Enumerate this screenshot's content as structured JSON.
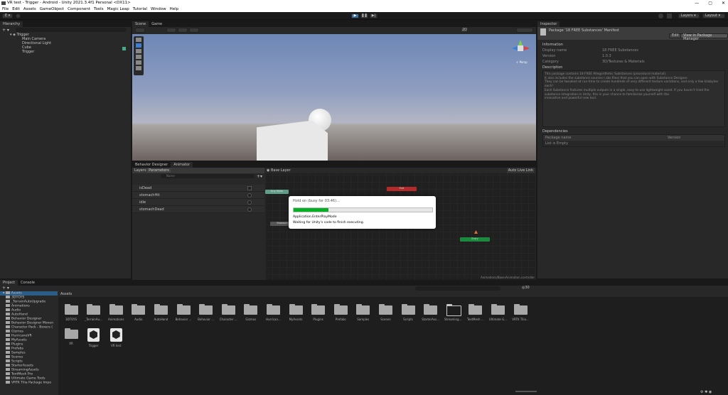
{
  "window": {
    "title": "VR test - Trigger - Android - Unity 2021.3.4f1 Personal <DX11>",
    "min": "—",
    "max": "▢",
    "close": "✕"
  },
  "menu": [
    "File",
    "Edit",
    "Assets",
    "GameObject",
    "Component",
    "Tools",
    "Magic Leap",
    "Tutorial",
    "Window",
    "Help"
  ],
  "toolbar": {
    "account": "E ▾",
    "layers": "Layers",
    "layout": "Layout"
  },
  "hierarchy": {
    "tab": "Hierarchy",
    "scene": "Trigger",
    "items": [
      "Main Camera",
      "Directional Light",
      "Cube",
      "Trigger"
    ]
  },
  "scene": {
    "tabs": [
      "Scene",
      "Game"
    ],
    "persp": "< Persp",
    "btn2d": "2D"
  },
  "inspector": {
    "tab": "Inspector",
    "title": "Package '18 FREE Substances' Manifest",
    "edit": "Edit",
    "view_pm": "View in Package Manager",
    "info_header": "Information",
    "rows": [
      {
        "k": "Display name",
        "v": "18 FREE Substances"
      },
      {
        "k": "Version",
        "v": "1.0.3"
      },
      {
        "k": "Category",
        "v": "3D/Textures & Materials"
      }
    ],
    "desc_header": "Description",
    "desc": [
      "This package contains 18 FREE Allegorithmic Substances (procedural material).",
      "It also includes the substance sources (.sbs files) that you can open with Substance Designer.",
      "They can be tweaked at run-time to create hundreds of very different texture variations, and only a few kilobytes each!",
      "Each Substance features multiple outputs in a single, easy-to-use lightweight asset. If you haven't tried the substance integration in Unity, this is your chance to familiarize yourself with the",
      "innovative and powerful new tool."
    ],
    "deps_header": "Dependencies",
    "deps_cols": [
      "Package name",
      "Version"
    ],
    "deps_empty": "List is Empty"
  },
  "animator": {
    "tabs": [
      "Behavior Designer",
      "Animator"
    ],
    "subtabs": [
      "Layers",
      "Parameters"
    ],
    "search": "Name",
    "layer": "Base Layer",
    "auto_live": "Auto Live Link",
    "params": [
      {
        "name": "isDead",
        "type": "bool"
      },
      {
        "name": "stomachHit",
        "type": "trigger"
      },
      {
        "name": "idle",
        "type": "trigger"
      },
      {
        "name": "stomachDead",
        "type": "trigger"
      }
    ],
    "path": "Animations/BoxerAnimation.controller",
    "states": [
      "Any State",
      "Exit",
      "Entry",
      "Stomach"
    ]
  },
  "dialog": {
    "title": "Hold on (busy for 03:46)...",
    "progress": 0.25,
    "line1": "Application.EnterPlayMode",
    "line2": "Waiting for Unity's code to finish executing."
  },
  "project": {
    "tabs": [
      "Project",
      "Console"
    ],
    "tree_header": "Assets",
    "breadcrumb": "Assets",
    "count": "30",
    "tree": [
      "3DTOYS",
      "_TerrainAutoUpgrade",
      "Animations",
      "Audio",
      "AutoHand",
      "Behavior Designer",
      "Behavior Designer Moven",
      "Character Pack - Boxers (",
      "Gizmos",
      "HurricaneVR",
      "MyAssets",
      "Plugins",
      "Prefabs",
      "Samples",
      "Scenes",
      "Scripts",
      "StarterAssets",
      "StreamingAssets",
      "TextMesh Pro",
      "Ultimate Game Tools",
      "VRTK Tilia Package Impo"
    ],
    "assets": [
      "3DTOYS",
      "_TerrainAu...",
      "Animations",
      "Audio",
      "AutoHand",
      "Behavior ...",
      "Behavior ...",
      "Character ...",
      "Gizmos",
      "Hurrican...",
      "MyAssets",
      "Plugins",
      "Prefabs",
      "Samples",
      "Scenes",
      "Scripts",
      "StarterAss...",
      "Streaming...",
      "TextMesh ...",
      "Ultimate G...",
      "VRTK Tilia...",
      "XR",
      "Trigger",
      "VR test"
    ]
  }
}
